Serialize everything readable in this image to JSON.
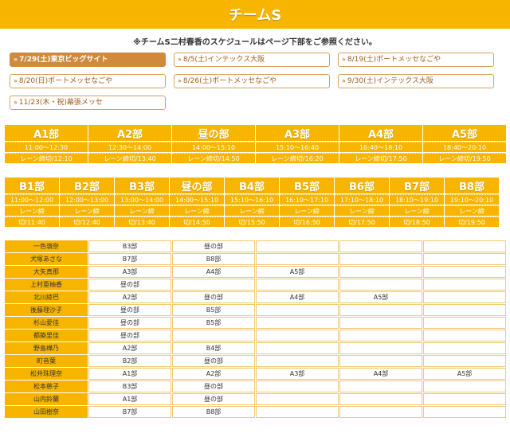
{
  "title": "チームS",
  "note": "※チームS二村春香のスケジュールはページ下部をご参照ください。",
  "dates": [
    {
      "label": "7/29(土)東京ビッグサイト",
      "active": true
    },
    {
      "label": "8/5(土)インテックス大阪",
      "active": false
    },
    {
      "label": "8/19(土)ポートメッセなごや",
      "active": false
    },
    {
      "label": "8/20(日)ポートメッセなごや",
      "active": false
    },
    {
      "label": "8/26(土)ポートメッセなごや",
      "active": false
    },
    {
      "label": "9/30(土)インテックス大阪",
      "active": false
    },
    {
      "label": "11/23(木・祝)幕張メッセ",
      "active": false
    }
  ],
  "slots_row1": [
    {
      "name": "A1部",
      "time": "11:00〜12:30",
      "deadline": "レーン締切/12:10"
    },
    {
      "name": "A2部",
      "time": "12:30〜14:00",
      "deadline": "レーン締切/13:40"
    },
    {
      "name": "昼の部",
      "time": "14:00〜15:10",
      "deadline": "レーン締切/14:50"
    },
    {
      "name": "A3部",
      "time": "15:10〜16:40",
      "deadline": "レーン締切/16:20"
    },
    {
      "name": "A4部",
      "time": "16:40〜18:10",
      "deadline": "レーン締切/17:50"
    },
    {
      "name": "A5部",
      "time": "18:40〜20:10",
      "deadline": "レーン締切/19:50"
    }
  ],
  "slots_row2": [
    {
      "name": "B1部",
      "time": "11:00〜12:00",
      "l1": "レーン締",
      "l2": "切/11:40"
    },
    {
      "name": "B2部",
      "time": "12:00〜13:00",
      "l1": "レーン締",
      "l2": "切/12:40"
    },
    {
      "name": "B3部",
      "time": "13:00〜14:00",
      "l1": "レーン締",
      "l2": "切/13:40"
    },
    {
      "name": "昼の部",
      "time": "14:00〜15:10",
      "l1": "レーン締",
      "l2": "切/14:50"
    },
    {
      "name": "B4部",
      "time": "15:10〜16:10",
      "l1": "レーン締",
      "l2": "切/15:50"
    },
    {
      "name": "B5部",
      "time": "16:10〜17:10",
      "l1": "レーン締",
      "l2": "切/16:50"
    },
    {
      "name": "B6部",
      "time": "17:10〜18:10",
      "l1": "レーン締",
      "l2": "切/17:50"
    },
    {
      "name": "B7部",
      "time": "18:10〜19:10",
      "l1": "レーン締",
      "l2": "切/18:50"
    },
    {
      "name": "B8部",
      "time": "19:10〜20:10",
      "l1": "レーン締",
      "l2": "切/19:50"
    }
  ],
  "members": [
    {
      "name": "一色嶺奈",
      "cells": [
        "B3部",
        "昼の部",
        "",
        "",
        ""
      ]
    },
    {
      "name": "犬塚あさな",
      "cells": [
        "B7部",
        "B8部",
        "",
        "",
        ""
      ]
    },
    {
      "name": "大矢真那",
      "cells": [
        "A3部",
        "A4部",
        "A5部",
        "",
        ""
      ]
    },
    {
      "name": "上村亜柚香",
      "cells": [
        "昼の部",
        "",
        "",
        "",
        ""
      ]
    },
    {
      "name": "北川綾巴",
      "cells": [
        "A2部",
        "昼の部",
        "A4部",
        "A5部",
        ""
      ]
    },
    {
      "name": "後藤理沙子",
      "cells": [
        "昼の部",
        "B5部",
        "",
        "",
        ""
      ]
    },
    {
      "name": "杉山愛佳",
      "cells": [
        "昼の部",
        "B5部",
        "",
        "",
        ""
      ]
    },
    {
      "name": "都築里佳",
      "cells": [
        "昼の部",
        "",
        "",
        "",
        ""
      ]
    },
    {
      "name": "野島樺乃",
      "cells": [
        "A2部",
        "B4部",
        "",
        "",
        ""
      ]
    },
    {
      "name": "町音葉",
      "cells": [
        "B2部",
        "昼の部",
        "",
        "",
        ""
      ]
    },
    {
      "name": "松井珠理奈",
      "cells": [
        "A1部",
        "A2部",
        "A3部",
        "A4部",
        "A5部"
      ]
    },
    {
      "name": "松本慈子",
      "cells": [
        "B3部",
        "昼の部",
        "",
        "",
        ""
      ]
    },
    {
      "name": "山内鈴蘭",
      "cells": [
        "A1部",
        "昼の部",
        "",
        "",
        ""
      ]
    },
    {
      "name": "山田樹奈",
      "cells": [
        "B7部",
        "B8部",
        "",
        "",
        ""
      ]
    }
  ]
}
